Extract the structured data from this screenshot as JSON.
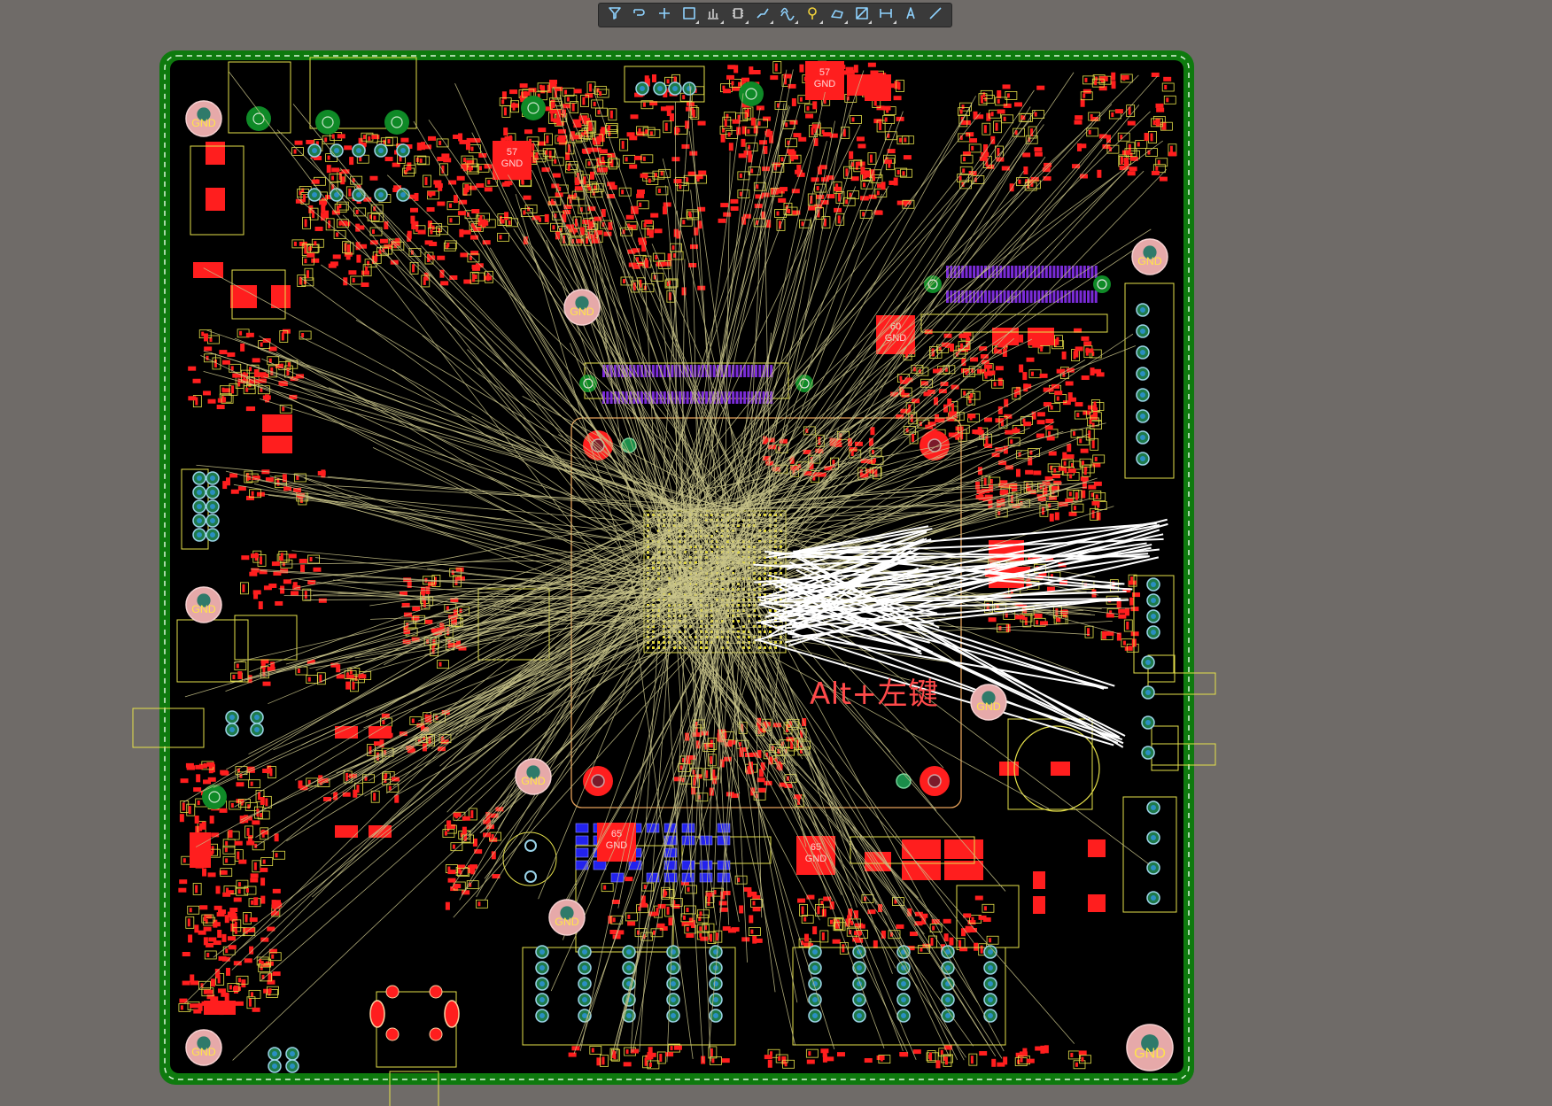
{
  "toolbar": {
    "tools": [
      {
        "name": "filter-icon",
        "color": "#8fd3ff",
        "dropdown": false
      },
      {
        "name": "route-icon",
        "color": "#8fd3ff",
        "dropdown": false
      },
      {
        "name": "add-icon",
        "color": "#8fd3ff",
        "dropdown": false
      },
      {
        "name": "select-rect-icon",
        "color": "#8fd3ff",
        "dropdown": true
      },
      {
        "name": "align-icon",
        "color": "#d0d0d0",
        "dropdown": true
      },
      {
        "name": "component-icon",
        "color": "#d0d0d0",
        "dropdown": true
      },
      {
        "name": "interactive-route-icon",
        "color": "#8fd3ff",
        "dropdown": true
      },
      {
        "name": "diff-pair-icon",
        "color": "#8fd3ff",
        "dropdown": true
      },
      {
        "name": "via-icon",
        "color": "#f3d33a",
        "dropdown": true
      },
      {
        "name": "polygon-icon",
        "color": "#8fd3ff",
        "dropdown": true
      },
      {
        "name": "keepout-icon",
        "color": "#8fd3ff",
        "dropdown": true
      },
      {
        "name": "dimension-icon",
        "color": "#8fd3ff",
        "dropdown": true
      },
      {
        "name": "string-icon",
        "color": "#8fd3ff",
        "dropdown": false
      },
      {
        "name": "line-icon",
        "color": "#8fd3ff",
        "dropdown": false
      }
    ]
  },
  "board": {
    "gnd_label": "GND",
    "chip_labels": [
      "57",
      "65",
      "62",
      "60"
    ],
    "colors": {
      "board_edge": "#0e7a0e",
      "board_fill": "#000000",
      "pad": "#ff1e1e",
      "silk": "#e5e04a",
      "ratsnest": "#c9c48a",
      "selected_net": "#ffffff",
      "purple_pads": "#7a2bd8",
      "blue_pads": "#2222ee"
    }
  },
  "hint": {
    "text": "Alt+左键"
  }
}
